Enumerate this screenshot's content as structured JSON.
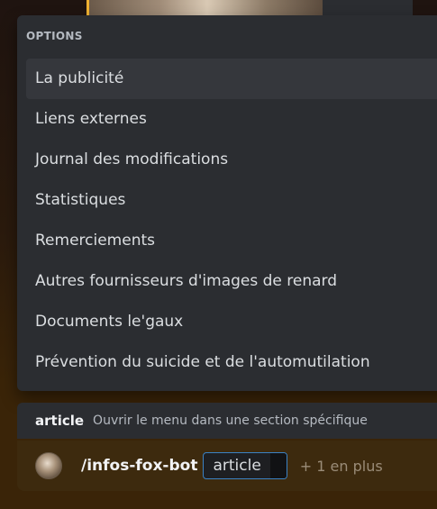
{
  "popup": {
    "header": "OPTIONS",
    "options": [
      "La publicité",
      "Liens externes",
      "Journal des modifications",
      "Statistiques",
      "Remerciements",
      "Autres fournisseurs d'images de renard",
      "Documents le'gaux",
      "Prévention du suicide et de l'automutilation"
    ],
    "selected_index": 0
  },
  "hint": {
    "option_name": "article",
    "description": "Ouvrir le menu dans une section spécifique"
  },
  "input": {
    "command": "/infos-fox-bot",
    "parameter": "article",
    "more_label": "+ 1 en plus"
  },
  "colors": {
    "popup_bg": "#2b2d31",
    "selected_bg": "#35373c",
    "param_border": "#3b82c4",
    "input_bg": "#3d2a0e"
  }
}
